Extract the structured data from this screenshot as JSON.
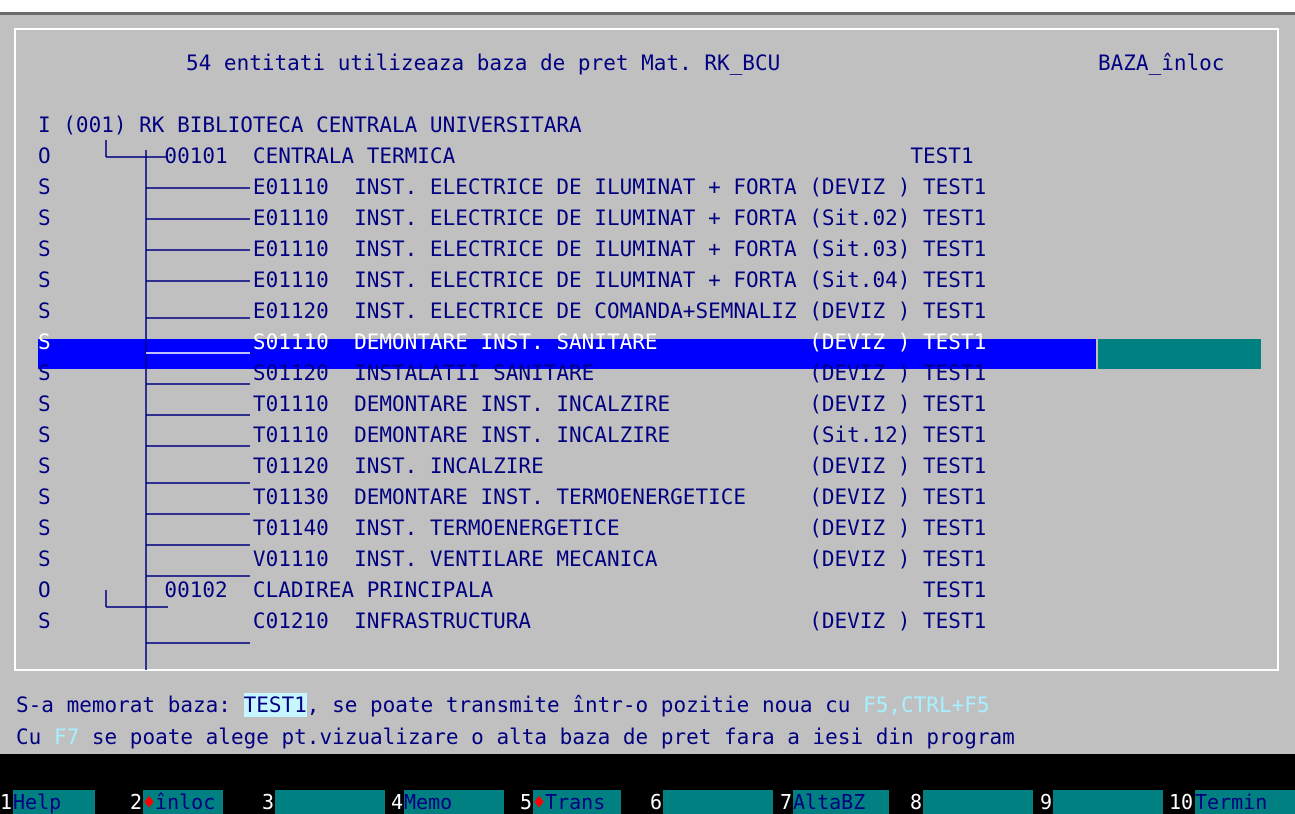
{
  "header": {
    "title": "54 entitati utilizeaza baza de pret Mat. RK_BCU",
    "column": "BAZA_înloc"
  },
  "rows": [
    {
      "text": "I (001) RK BIBLIOTECA CENTRALA UNIVERSITARA"
    },
    {
      "text": "O         00101  CENTRALA TERMICA                                    TEST1"
    },
    {
      "text": "S                E01110  INST. ELECTRICE DE ILUMINAT + FORTA (DEVIZ ) TEST1"
    },
    {
      "text": "S                E01110  INST. ELECTRICE DE ILUMINAT + FORTA (Sit.02) TEST1"
    },
    {
      "text": "S                E01110  INST. ELECTRICE DE ILUMINAT + FORTA (Sit.03) TEST1"
    },
    {
      "text": "S                E01110  INST. ELECTRICE DE ILUMINAT + FORTA (Sit.04) TEST1"
    },
    {
      "text": "S                E01120  INST. ELECTRICE DE COMANDA+SEMNALIZ (DEVIZ ) TEST1"
    },
    {
      "text": "S                S01110  DEMONTARE INST. SANITARE            (DEVIZ ) TEST1",
      "selected": true
    },
    {
      "text": "S                S01120  INSTALATII SANITARE                 (DEVIZ ) TEST1"
    },
    {
      "text": "S                T01110  DEMONTARE INST. INCALZIRE           (DEVIZ ) TEST1"
    },
    {
      "text": "S                T01110  DEMONTARE INST. INCALZIRE           (Sit.12) TEST1"
    },
    {
      "text": "S                T01120  INST. INCALZIRE                     (DEVIZ ) TEST1"
    },
    {
      "text": "S                T01130  DEMONTARE INST. TERMOENERGETICE     (DEVIZ ) TEST1"
    },
    {
      "text": "S                T01140  INST. TERMOENERGETICE               (DEVIZ ) TEST1"
    },
    {
      "text": "S                V01110  INST. VENTILARE MECANICA            (DEVIZ ) TEST1"
    },
    {
      "text": "O         00102  CLADIREA PRINCIPALA                                  TEST1"
    },
    {
      "text": "S                C01210  INFRASTRUCTURA                      (DEVIZ ) TEST1"
    }
  ],
  "status": {
    "line1_prefix": "S-a memorat baza: ",
    "line1_base": "TEST1",
    "line1_mid": ", se poate transmite într-o pozitie noua cu ",
    "line1_keys": "F5,CTRL+F5",
    "line2_prefix": "Cu ",
    "line2_key": "F7",
    "line2_rest": " se poate alege pt.vizualizare o alta baza de pret fara a iesi din program"
  },
  "fkeys": [
    {
      "num": "1",
      "label": "Help"
    },
    {
      "num": "2",
      "label": "înloc",
      "marker": "♦"
    },
    {
      "num": "3",
      "label": ""
    },
    {
      "num": "4",
      "label": "Memo"
    },
    {
      "num": "5",
      "label": "Trans",
      "marker": "♦"
    },
    {
      "num": "6",
      "label": ""
    },
    {
      "num": "7",
      "label": "AltaBZ"
    },
    {
      "num": "8",
      "label": ""
    },
    {
      "num": "9",
      "label": ""
    },
    {
      "num": "10",
      "label": "Termin"
    }
  ],
  "colors": {
    "background": "#c0c0c0",
    "text": "#000080",
    "selection": "#0000ff",
    "selection_base": "#008080",
    "fkey_bar": "#008080"
  }
}
